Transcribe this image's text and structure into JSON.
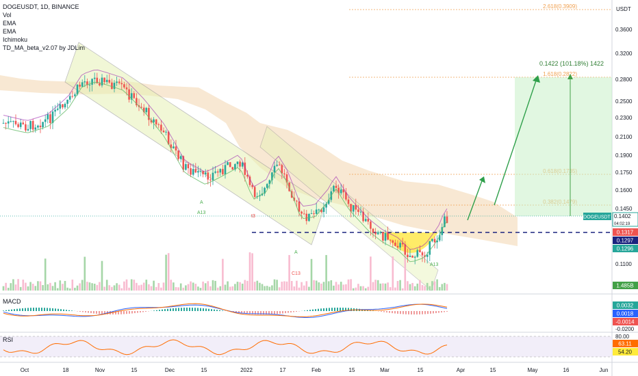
{
  "legend": {
    "symbol": "DOGEUSDT, 1D, BINANCE",
    "indicators": [
      "Vol",
      "EMA",
      "EMA",
      "Ichimoku",
      "TD_MA_beta_v2.07 by JDLim"
    ]
  },
  "axis": {
    "unit": "USDT",
    "price_ticks": [
      "0.3600",
      "0.3200",
      "0.2800",
      "0.2500",
      "0.2300",
      "0.2100",
      "0.1900",
      "0.1750",
      "0.1600",
      "0.1450",
      "0.1100"
    ],
    "macd_ticks": [
      "-0.0200"
    ],
    "rsi_ticks": [
      "80.00"
    ],
    "date_ticks": [
      "Oct",
      "18",
      "Nov",
      "15",
      "Dec",
      "15",
      "2022",
      "17",
      "Feb",
      "15",
      "Mar",
      "15",
      "Apr",
      "15",
      "May",
      "16",
      "Jun"
    ]
  },
  "fib_levels": [
    {
      "label": "2.618(0.3909)",
      "color": "#f0a050"
    },
    {
      "label": "1.618(0.2822)",
      "color": "#f0a050"
    },
    {
      "label": "0.618(0.1735)",
      "color": "#f0a050"
    },
    {
      "label": "0.382(0.1479)",
      "color": "#f0a050"
    }
  ],
  "measurement": {
    "text": "0.1422 (101.18%) 1422"
  },
  "badges": {
    "symbol": "DOGEUSDT",
    "last_price": "0.1402",
    "countdown": "04:02:19",
    "red_level": "0.1317",
    "navy_level": "0.1297",
    "green_level": "0.1296",
    "volume": "1.485B",
    "macd_1": "0.0032",
    "macd_2": "0.0018",
    "macd_3": "-0.0014",
    "rsi_1": "63.11",
    "rsi_2": "54.20"
  },
  "panes": {
    "macd": "MACD",
    "rsi": "RSI"
  },
  "annotations": {
    "a13_1": "A13",
    "t3": "t3",
    "a_1": "A",
    "c13": "C13",
    "a13_2": "A13",
    "c_mark": "A"
  },
  "colors": {
    "up": "#26a69a",
    "down": "#ef5350",
    "accent_green": "#43a047",
    "cloud": "#f6e2c8",
    "channel": "#e6f2b5"
  }
}
